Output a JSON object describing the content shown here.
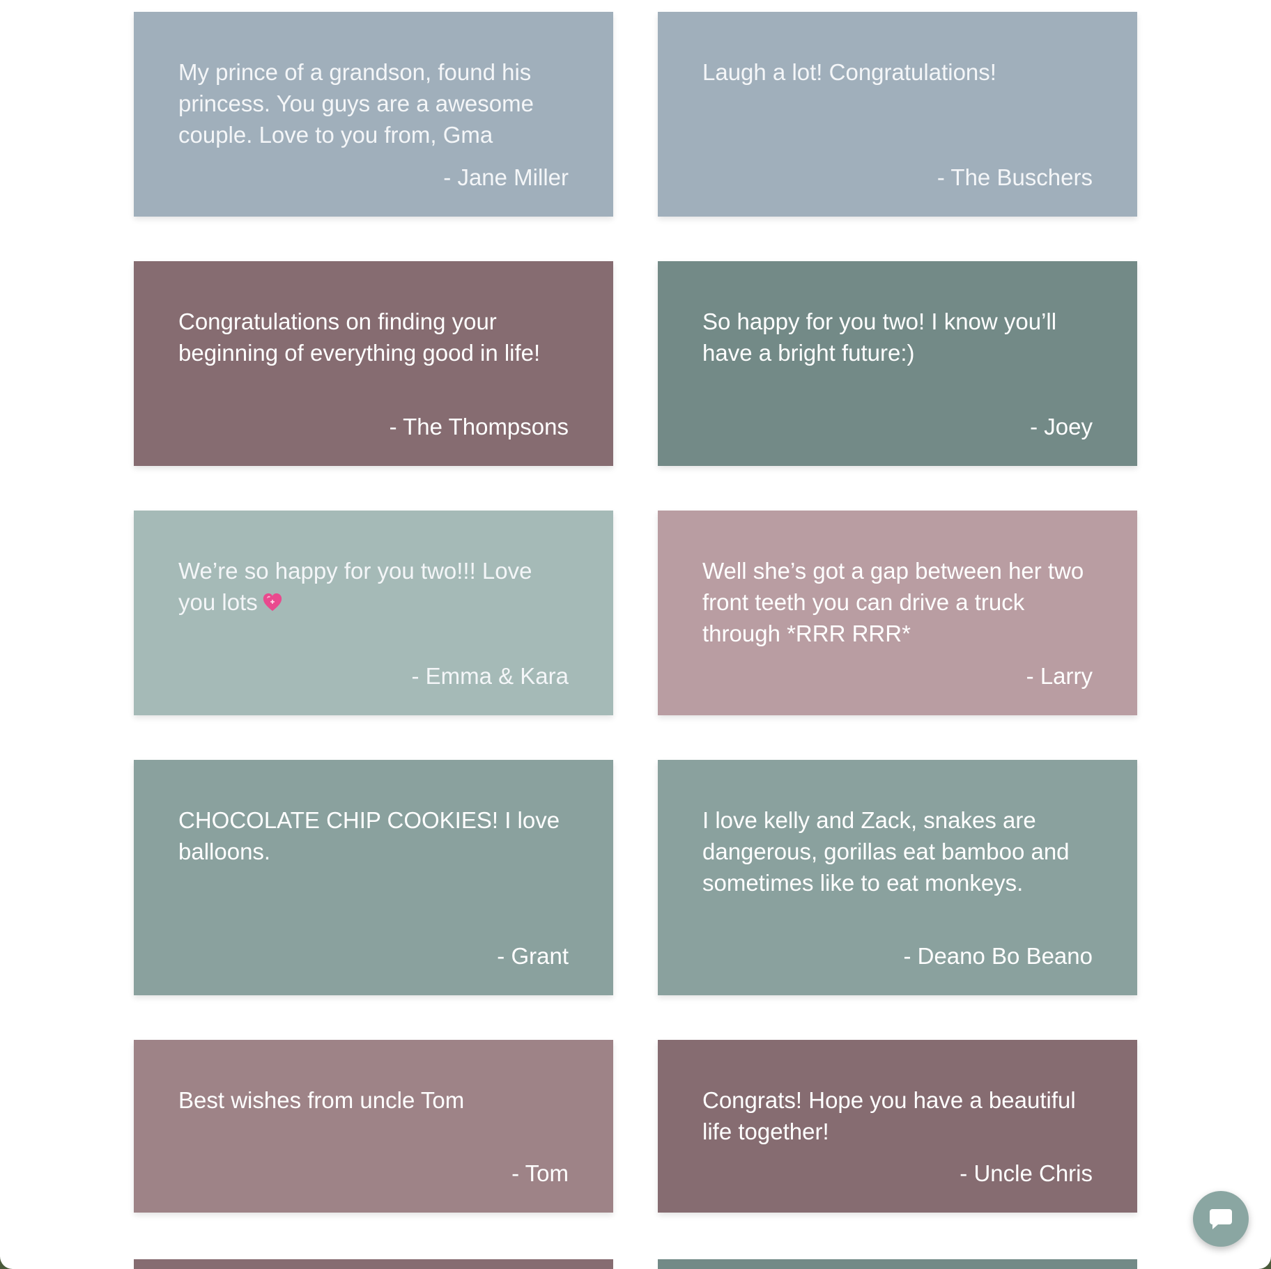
{
  "cards": [
    {
      "message": "My prince of a grandson, found his princess. You guys are a awesome couple. Love to you from, Gma",
      "author": "- Jane Miller",
      "color": "#a0afbb"
    },
    {
      "message": "Laugh a lot! Congratulations!",
      "author": "- The Buschers",
      "color": "#a0afbb"
    },
    {
      "message": "Congratulations on finding your beginning of everything good in life!",
      "author": "- The Thompsons",
      "color": "#866c71"
    },
    {
      "message": "So happy for you two! I know you’ll have a bright future:)",
      "author": "- Joey",
      "color": "#738a87"
    },
    {
      "message": "We’re so happy for you two!!! Love you lots",
      "author": "- Emma & Kara",
      "color": "#a5bab7",
      "emoji": "heart-emoji"
    },
    {
      "message": "Well she’s got a gap between her two front teeth you can drive a truck through *RRR RRR*",
      "author": "- Larry",
      "color": "#b99da2"
    },
    {
      "message": "CHOCOLATE CHIP COOKIES! I love balloons.",
      "author": "- Grant",
      "color": "#8aa19e"
    },
    {
      "message": "I love kelly and Zack, snakes are dangerous, gorillas eat bamboo and sometimes like to eat monkeys.",
      "author": "- Deano Bo Beano",
      "color": "#8aa19e"
    },
    {
      "message": "Best wishes from uncle Tom",
      "author": "- Tom",
      "color": "#9e8387"
    },
    {
      "message": "Congrats! Hope you have a beautiful life together!",
      "author": "- Uncle Chris",
      "color": "#866c71"
    }
  ],
  "partial_cards": [
    {
      "color": "#866c71"
    },
    {
      "color": "#738a87"
    }
  ],
  "chat_button": {
    "icon": "chat-bubble-icon",
    "color": "#8aa6a2"
  }
}
